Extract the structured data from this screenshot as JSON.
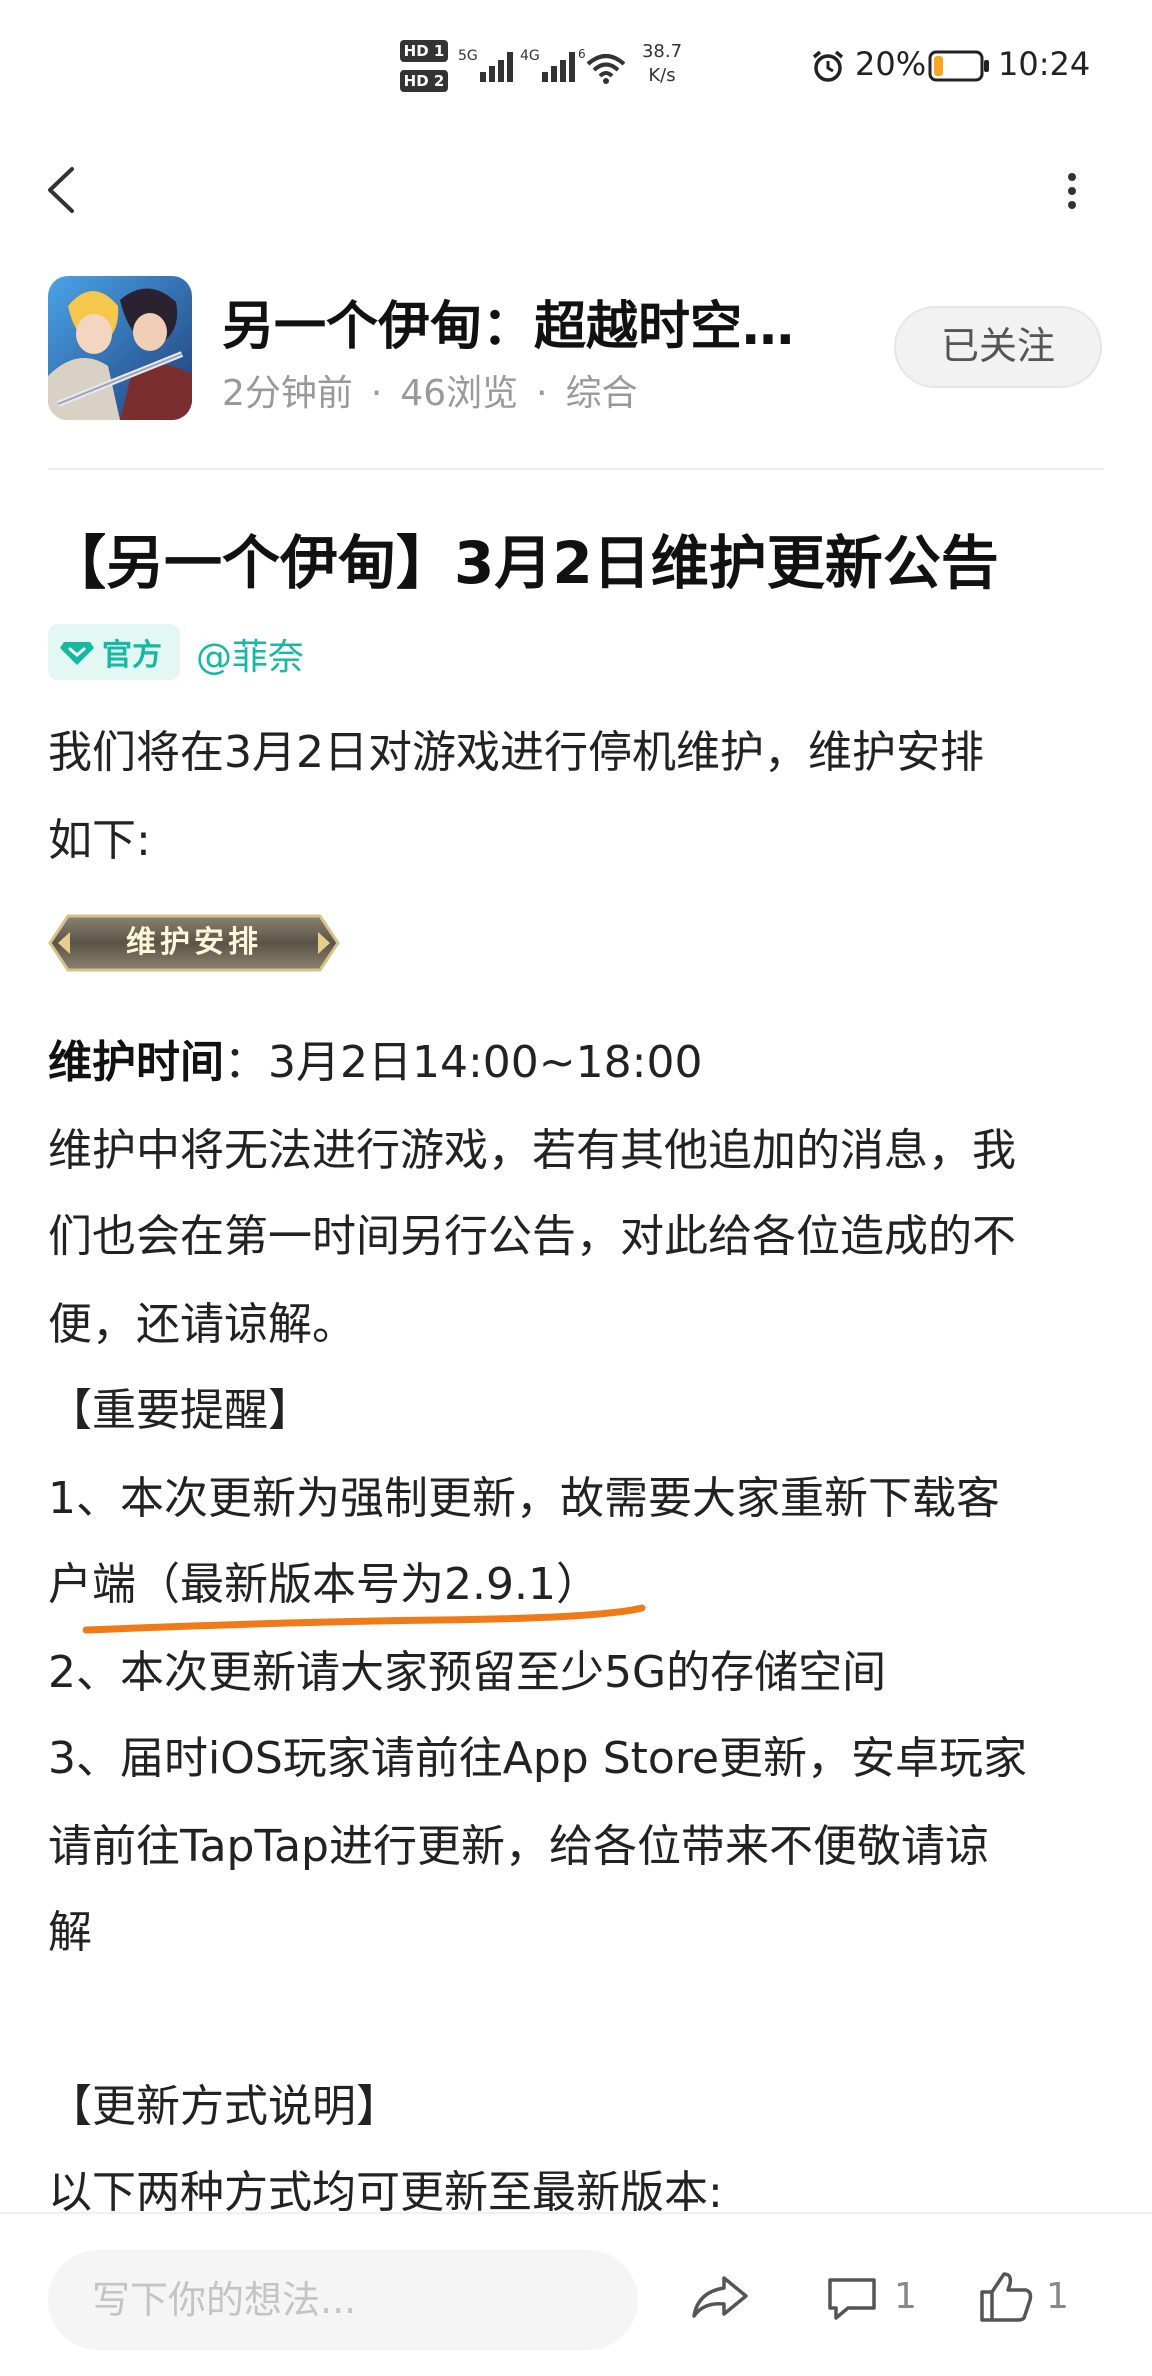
{
  "status_bar": {
    "hd1": "HD 1",
    "hd2": "HD 2",
    "signal1_label": "5G",
    "signal2_label": "4G",
    "wifi_label": "6",
    "net_speed_value": "38.7",
    "net_speed_unit": "K/s",
    "battery_percent": "20%",
    "time": "10:24",
    "battery_level": 0.2,
    "battery_color": "#f5a623"
  },
  "nav": {
    "back_icon": "chevron-left-icon",
    "more_icon": "more-vertical-icon"
  },
  "header": {
    "title": "另一个伊甸：超越时空…",
    "time_ago": "2分钟前",
    "views": "46浏览",
    "category": "综合",
    "follow_label": "已关注"
  },
  "article": {
    "title": "【另一个伊甸】3月2日维护更新公告",
    "official_label": "官方",
    "author": "@菲奈",
    "intro_line1": "我们将在3月2日对游戏进行停机维护，维护安排",
    "intro_line2": "如下:",
    "banner_label": "维护安排",
    "maint_time_label": "维护时间",
    "maint_time_value": "：3月2日14:00~18:00",
    "body_line1": "维护中将无法进行游戏，若有其他追加的消息，我",
    "body_line2": "们也会在第一时间另行公告，对此给各位造成的不",
    "body_line3": "便，还请谅解。",
    "reminder_heading": "【重要提醒】",
    "item1_line1": "1、本次更新为强制更新，故需要大家重新下载客",
    "item1_line2": "户端（最新版本号为2.9.1）",
    "item2": "2、本次更新请大家预留至少5G的存储空间",
    "item3_line1": "3、届时iOS玩家请前往App Store更新，安卓玩家",
    "item3_line2": "请前往TapTap进行更新，给各位带来不便敬请谅",
    "item3_line3": "解",
    "update_heading": "【更新方式说明】",
    "update_line": "以下两种方式均可更新至最新版本:"
  },
  "bottom_bar": {
    "comment_placeholder": "写下你的想法...",
    "comment_count": "1",
    "like_count": "1"
  },
  "colors": {
    "accent": "#15b9a2",
    "annotation": "#f07a17"
  }
}
